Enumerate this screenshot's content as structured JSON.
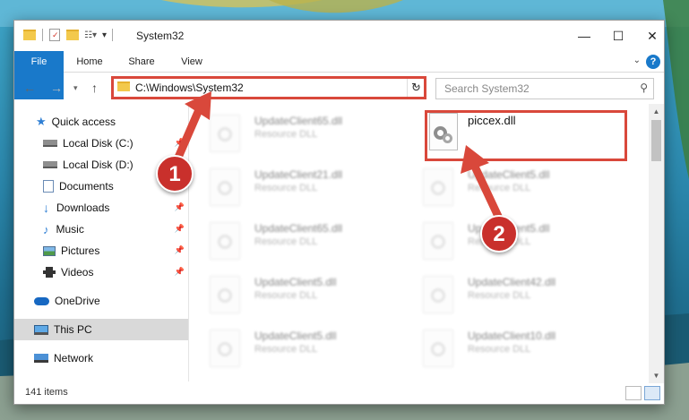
{
  "window": {
    "title": "System32",
    "controls": {
      "minimize": "—",
      "maximize": "☐",
      "close": "✕"
    }
  },
  "ribbon": {
    "tabs": [
      {
        "label": "File"
      },
      {
        "label": "Home"
      },
      {
        "label": "Share"
      },
      {
        "label": "View"
      }
    ],
    "help": "?"
  },
  "nav": {
    "address": "C:\\Windows\\System32",
    "search_placeholder": "Search System32"
  },
  "sidebar": {
    "items": [
      {
        "label": "Quick access",
        "icon": "star-icon",
        "pinned": false
      },
      {
        "label": "Local Disk (C:)",
        "icon": "drive-icon",
        "pinned": true
      },
      {
        "label": "Local Disk (D:)",
        "icon": "drive-icon",
        "pinned": false
      },
      {
        "label": "Documents",
        "icon": "documents-icon",
        "pinned": true
      },
      {
        "label": "Downloads",
        "icon": "downloads-icon",
        "pinned": true
      },
      {
        "label": "Music",
        "icon": "music-icon",
        "pinned": true
      },
      {
        "label": "Pictures",
        "icon": "pictures-icon",
        "pinned": true
      },
      {
        "label": "Videos",
        "icon": "videos-icon",
        "pinned": true
      },
      {
        "label": "OneDrive",
        "icon": "cloud-icon",
        "pinned": false
      },
      {
        "label": "This PC",
        "icon": "computer-icon",
        "pinned": false,
        "selected": true
      },
      {
        "label": "Network",
        "icon": "network-icon",
        "pinned": false
      }
    ]
  },
  "files": {
    "left": [
      {
        "name": "UpdateClient65.dll",
        "type": "Resource DLL"
      },
      {
        "name": "UpdateClient21.dll",
        "type": "Resource DLL"
      },
      {
        "name": "UpdateClient65.dll",
        "type": "Resource DLL"
      },
      {
        "name": "UpdateClient5.dll",
        "type": "Resource DLL"
      },
      {
        "name": "UpdateClient5.dll",
        "type": "Resource DLL"
      }
    ],
    "right": [
      {
        "name": "piccex.dll",
        "type": ""
      },
      {
        "name": "UpdateClient5.dll",
        "type": "Resource DLL"
      },
      {
        "name": "UpdateClient5.dll",
        "type": "Resource DLL"
      },
      {
        "name": "UpdateClient42.dll",
        "type": "Resource DLL"
      },
      {
        "name": "UpdateClient10.dll",
        "type": "Resource DLL"
      }
    ]
  },
  "status": {
    "count": "141 items"
  },
  "callouts": {
    "one": "1",
    "two": "2"
  },
  "colors": {
    "accent": "#1979ca",
    "highlight": "#d9483b",
    "badge": "#c9302c"
  }
}
